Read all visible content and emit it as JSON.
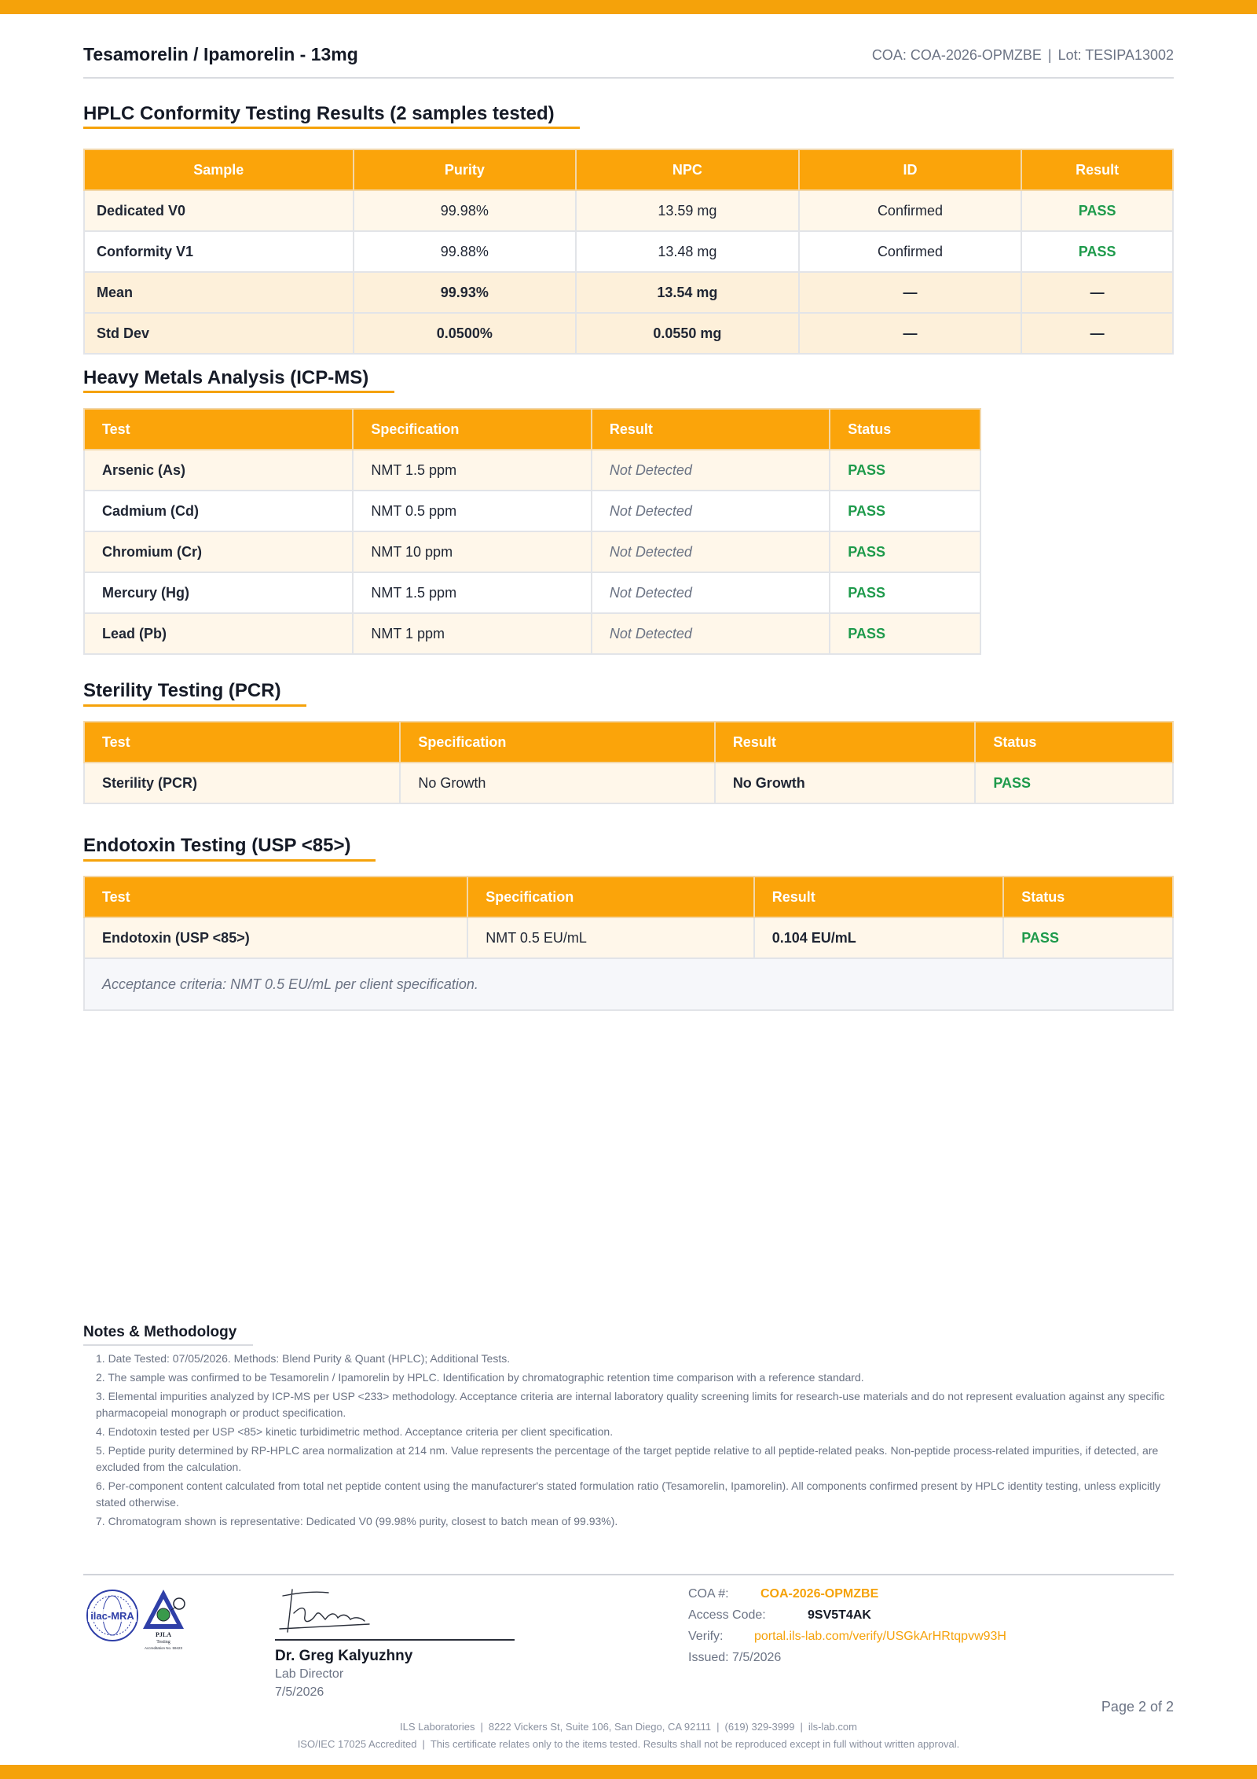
{
  "header": {
    "title": "Tesamorelin / Ipamorelin - 13mg",
    "coa": "COA: COA-2026-OPMZBE",
    "lot": "Lot: TESIPA13002"
  },
  "hplc": {
    "title": "HPLC Conformity Testing Results (2 samples tested)",
    "columns": [
      "Sample",
      "Purity",
      "NPC",
      "ID",
      "Result"
    ],
    "rows": [
      {
        "sample": "Dedicated V0",
        "purity": "99.98%",
        "npc": "13.59 mg",
        "id": "Confirmed",
        "result": "PASS"
      },
      {
        "sample": "Conformity V1",
        "purity": "99.88%",
        "npc": "13.48 mg",
        "id": "Confirmed",
        "result": "PASS"
      }
    ],
    "mean": {
      "sample": "Mean",
      "purity": "99.93%",
      "npc": "13.54 mg",
      "id": "—",
      "result": "—"
    },
    "stddev": {
      "sample": "Std Dev",
      "purity": "0.0500%",
      "npc": "0.0550 mg",
      "id": "—",
      "result": "—"
    }
  },
  "metals": {
    "title": "Heavy Metals Analysis (ICP-MS)",
    "columns": [
      "Test",
      "Specification",
      "Result",
      "Status"
    ],
    "rows": [
      {
        "test": "Arsenic (As)",
        "spec": "NMT 1.5 ppm",
        "result": "Not Detected",
        "status": "PASS"
      },
      {
        "test": "Cadmium (Cd)",
        "spec": "NMT 0.5 ppm",
        "result": "Not Detected",
        "status": "PASS"
      },
      {
        "test": "Chromium (Cr)",
        "spec": "NMT 10 ppm",
        "result": "Not Detected",
        "status": "PASS"
      },
      {
        "test": "Mercury (Hg)",
        "spec": "NMT 1.5 ppm",
        "result": "Not Detected",
        "status": "PASS"
      },
      {
        "test": "Lead (Pb)",
        "spec": "NMT 1 ppm",
        "result": "Not Detected",
        "status": "PASS"
      }
    ]
  },
  "sterility": {
    "title": "Sterility Testing (PCR)",
    "columns": [
      "Test",
      "Specification",
      "Result",
      "Status"
    ],
    "row": {
      "test": "Sterility (PCR)",
      "spec": "No Growth",
      "result": "No Growth",
      "status": "PASS"
    }
  },
  "endotoxin": {
    "title": "Endotoxin Testing (USP <85>)",
    "columns": [
      "Test",
      "Specification",
      "Result",
      "Status"
    ],
    "row": {
      "test": "Endotoxin (USP <85>)",
      "spec": "NMT 0.5 EU/mL",
      "result": "0.104 EU/mL",
      "status": "PASS"
    },
    "criteria": "Acceptance criteria: NMT 0.5 EU/mL per client specification."
  },
  "notes": {
    "title": "Notes & Methodology",
    "items": [
      "1. Date Tested: 07/05/2026. Methods: Blend Purity & Quant (HPLC); Additional Tests.",
      "2. The sample was confirmed to be Tesamorelin / Ipamorelin by HPLC. Identification by chromatographic retention time comparison with a reference standard.",
      "3. Elemental impurities analyzed by ICP-MS per USP <233> methodology. Acceptance criteria are internal laboratory quality screening limits for research-use materials and do not represent evaluation against any specific pharmacopeial monograph or product specification.",
      "4. Endotoxin tested per USP <85> kinetic turbidimetric method. Acceptance criteria per client specification.",
      "5. Peptide purity determined by RP-HPLC area normalization at 214 nm. Value represents the percentage of the target peptide relative to all peptide-related peaks. Non-peptide process-related impurities, if detected, are excluded from the calculation.",
      "6. Per-component content calculated from total net peptide content using the manufacturer's stated formulation ratio (Tesamorelin, Ipamorelin). All components confirmed present by HPLC identity testing, unless explicitly stated otherwise.",
      "7. Chromatogram shown is representative: Dedicated V0 (99.98% purity, closest to batch mean of 99.93%)."
    ]
  },
  "badges": {
    "ilac": "ilac-MRA",
    "pjla_name": "PJLA",
    "pjla_sub": "Testing",
    "pjla_accred": "Accreditation No. 59423"
  },
  "signer": {
    "name": "Dr. Greg Kalyuzhny",
    "role": "Lab Director",
    "date": "7/5/2026"
  },
  "coa_info": {
    "coa_label": "COA #:",
    "coa_value": "COA-2026-OPMZBE",
    "access_label": "Access Code:",
    "access_value": "9SV5T4AK",
    "verify_label": "Verify:",
    "verify_value": "portal.ils-lab.com/verify/USGkArHRtqpvw93H",
    "issued": "Issued: 7/5/2026"
  },
  "page": "Page 2 of 2",
  "footer": {
    "lab": "ILS Laboratories",
    "address": "8222 Vickers St, Suite 106, San Diego, CA 92111",
    "phone": "(619) 329-3999",
    "site": "ils-lab.com",
    "accred": "ISO/IEC 17025 Accredited",
    "disclaimer": "This certificate relates only to the items tested. Results shall not be reproduced except in full without written approval."
  },
  "colors": {
    "accent": "#f5a20a",
    "pass": "#1e9a4b",
    "muted": "#6b7384"
  }
}
